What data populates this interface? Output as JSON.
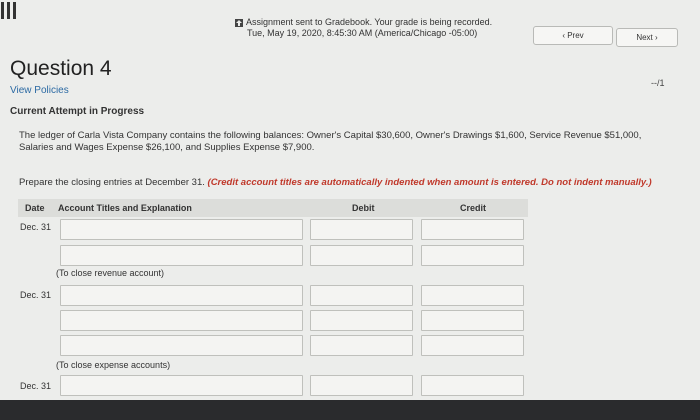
{
  "header": {
    "notice_line1": "Assignment sent to Gradebook. Your grade is being recorded.",
    "notice_line2": "Tue, May 19, 2020, 8:45:30 AM (America/Chicago -05:00)",
    "prev_label": "‹ Prev",
    "next_label": "Next ›"
  },
  "question": {
    "title": "Question 4",
    "score": "--/1",
    "view_policies": "View Policies",
    "attempt_status": "Current Attempt in Progress",
    "problem_text": "The ledger of Carla Vista Company contains the following balances: Owner's Capital $30,600, Owner's Drawings $1,600, Service Revenue $51,000, Salaries and Wages Expense $26,100, and Supplies Expense $7,900.",
    "prepare_text": "Prepare the closing entries at December 31.",
    "prepare_note": "(Credit account titles are automatically indented when amount is entered. Do not indent manually.)"
  },
  "table": {
    "headers": {
      "date": "Date",
      "account": "Account Titles and Explanation",
      "debit": "Debit",
      "credit": "Credit"
    },
    "entries": [
      {
        "date": "Dec. 31",
        "explanation": "(To close revenue account)"
      },
      {
        "date": "Dec. 31",
        "explanation": "(To close expense accounts)"
      },
      {
        "date": "Dec. 31"
      }
    ]
  },
  "icons": [
    "menu-icon",
    "upload-icon"
  ]
}
